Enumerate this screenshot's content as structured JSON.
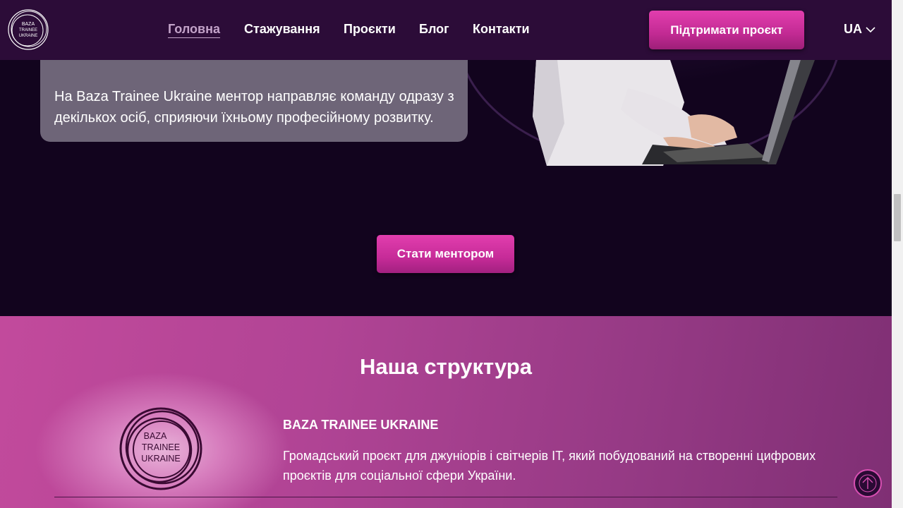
{
  "header": {
    "logo_text": "BAZA TRAINEE UKRAINE",
    "nav": [
      {
        "label": "Головна",
        "active": true
      },
      {
        "label": "Стажування",
        "active": false
      },
      {
        "label": "Проєкти",
        "active": false
      },
      {
        "label": "Блог",
        "active": false
      },
      {
        "label": "Контакти",
        "active": false
      }
    ],
    "support_label": "Підтримати проєкт",
    "lang_label": "UA"
  },
  "hero": {
    "card_text": "На Baza Trainee Ukraine ментор направляє команду одразу з декількох осіб, сприяючи їхньому професійному розвитку.",
    "mentor_button_label": "Стати ментором"
  },
  "structure": {
    "heading": "Наша структура",
    "org_title": "BAZA TRAINEE UKRAINE",
    "org_description": "Громадський проєкт для джуніорів і світчерів IT, який побудований на створенні цифрових проєктів для соціальної сфери України.",
    "logo_lines": [
      "BAZA",
      "TRAINEE",
      "UKRAINE"
    ]
  },
  "colors": {
    "header_bg": "#2c0c38",
    "page_bg": "#12041e",
    "accent": "#d23aa5",
    "card_bg": "#6e6578"
  }
}
